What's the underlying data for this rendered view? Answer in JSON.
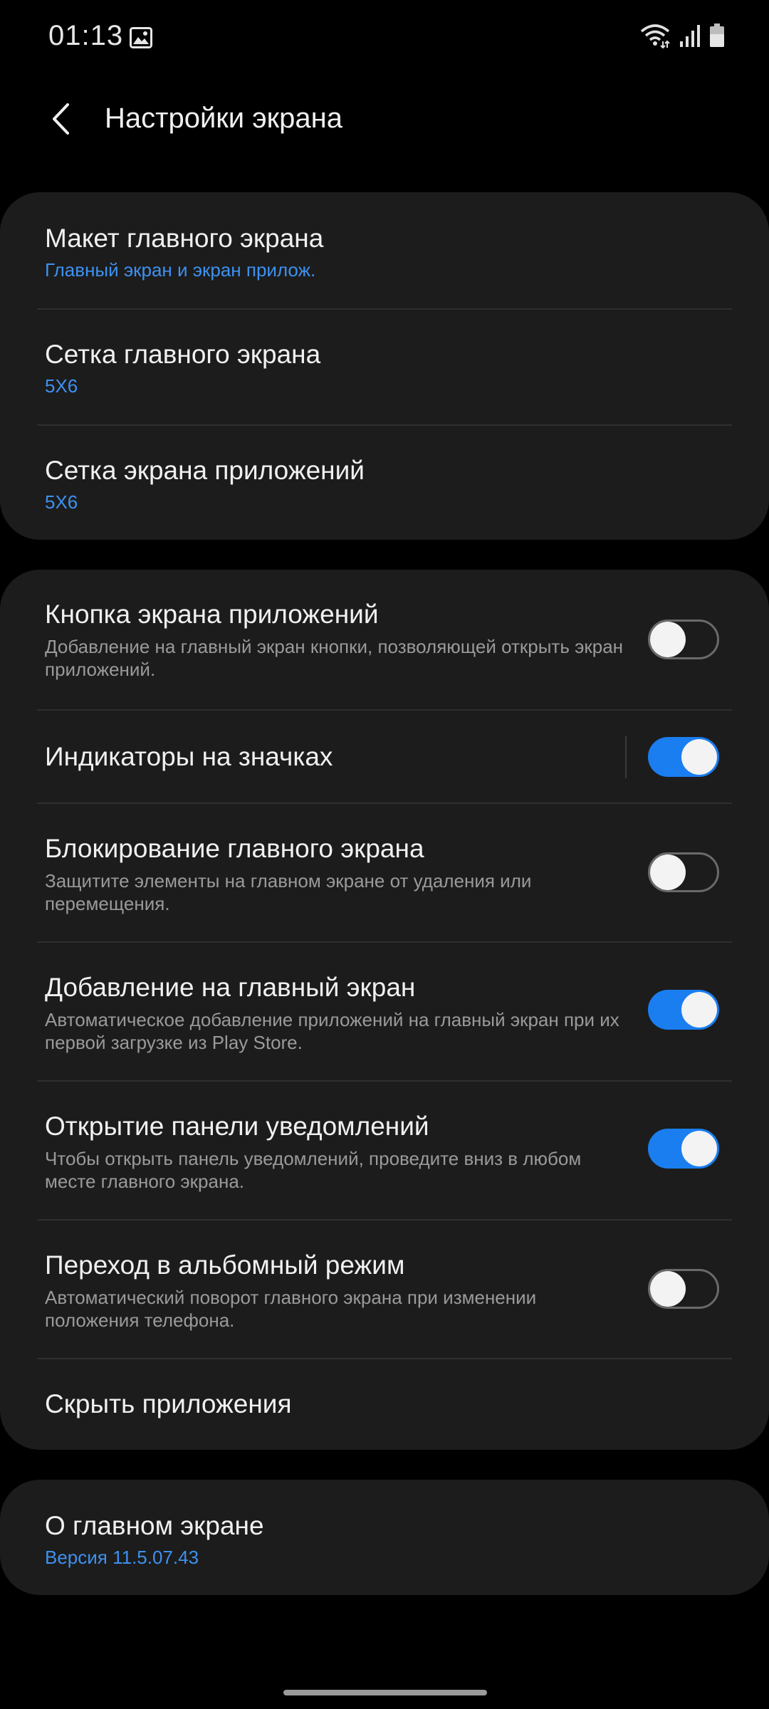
{
  "status_bar": {
    "time": "01:13",
    "left_icons": [
      "gallery-icon"
    ],
    "right_icons": [
      "wifi-icon",
      "signal-icon",
      "battery-icon"
    ]
  },
  "header": {
    "title": "Настройки экрана",
    "back_icon": "chevron-left-icon"
  },
  "group1": {
    "items": [
      {
        "title": "Макет главного экрана",
        "value": "Главный экран и экран прилож."
      },
      {
        "title": "Сетка главного экрана",
        "value": "5X6"
      },
      {
        "title": "Сетка экрана приложений",
        "value": "5X6"
      }
    ]
  },
  "group2": {
    "items": [
      {
        "title": "Кнопка экрана приложений",
        "description": "Добавление на главный экран кнопки, позволяющей открыть экран приложений.",
        "toggle": false
      },
      {
        "title": "Индикаторы на значках",
        "toggle": true
      },
      {
        "title": "Блокирование главного экрана",
        "description": "Защитите элементы на главном экране от удаления или перемещения.",
        "toggle": false
      },
      {
        "title": "Добавление на главный экран",
        "description": "Автоматическое добавление приложений на главный экран при их первой загрузке из Play Store.",
        "toggle": true
      },
      {
        "title": "Открытие панели уведомлений",
        "description": "Чтобы открыть панель уведомлений, проведите вниз в любом месте главного экрана.",
        "toggle": true
      },
      {
        "title": "Переход в альбомный режим",
        "description": "Автоматический поворот главного экрана при изменении положения телефона.",
        "toggle": false
      },
      {
        "title": "Скрыть приложения"
      }
    ]
  },
  "group3": {
    "items": [
      {
        "title": "О главном экране",
        "value": "Версия 11.5.07.43"
      }
    ]
  },
  "colors": {
    "background": "#000000",
    "card": "#1c1c1c",
    "accent": "#1a7ef0",
    "link_text": "#3e91f0",
    "secondary_text": "#9a9a9a"
  }
}
